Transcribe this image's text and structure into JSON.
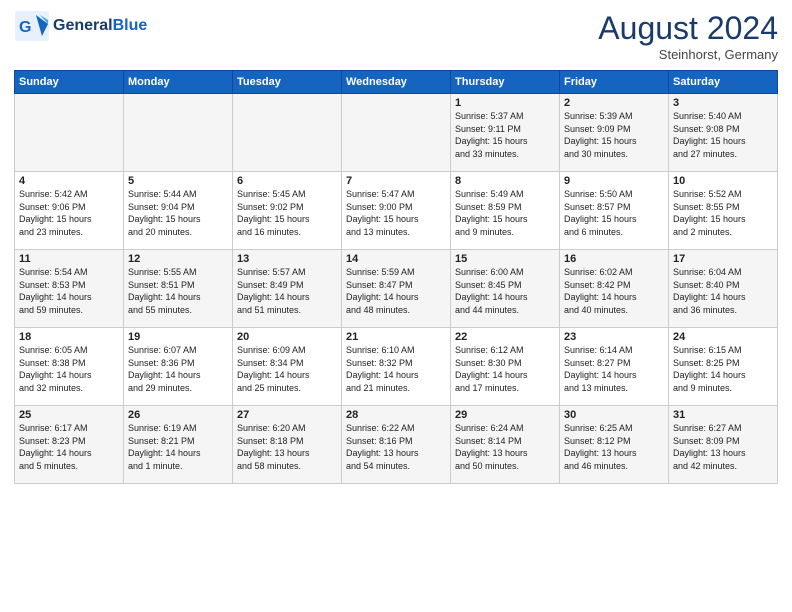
{
  "header": {
    "logo_general": "General",
    "logo_blue": "Blue",
    "month_year": "August 2024",
    "location": "Steinhorst, Germany"
  },
  "weekdays": [
    "Sunday",
    "Monday",
    "Tuesday",
    "Wednesday",
    "Thursday",
    "Friday",
    "Saturday"
  ],
  "weeks": [
    [
      {
        "day": "",
        "info": ""
      },
      {
        "day": "",
        "info": ""
      },
      {
        "day": "",
        "info": ""
      },
      {
        "day": "",
        "info": ""
      },
      {
        "day": "1",
        "info": "Sunrise: 5:37 AM\nSunset: 9:11 PM\nDaylight: 15 hours\nand 33 minutes."
      },
      {
        "day": "2",
        "info": "Sunrise: 5:39 AM\nSunset: 9:09 PM\nDaylight: 15 hours\nand 30 minutes."
      },
      {
        "day": "3",
        "info": "Sunrise: 5:40 AM\nSunset: 9:08 PM\nDaylight: 15 hours\nand 27 minutes."
      }
    ],
    [
      {
        "day": "4",
        "info": "Sunrise: 5:42 AM\nSunset: 9:06 PM\nDaylight: 15 hours\nand 23 minutes."
      },
      {
        "day": "5",
        "info": "Sunrise: 5:44 AM\nSunset: 9:04 PM\nDaylight: 15 hours\nand 20 minutes."
      },
      {
        "day": "6",
        "info": "Sunrise: 5:45 AM\nSunset: 9:02 PM\nDaylight: 15 hours\nand 16 minutes."
      },
      {
        "day": "7",
        "info": "Sunrise: 5:47 AM\nSunset: 9:00 PM\nDaylight: 15 hours\nand 13 minutes."
      },
      {
        "day": "8",
        "info": "Sunrise: 5:49 AM\nSunset: 8:59 PM\nDaylight: 15 hours\nand 9 minutes."
      },
      {
        "day": "9",
        "info": "Sunrise: 5:50 AM\nSunset: 8:57 PM\nDaylight: 15 hours\nand 6 minutes."
      },
      {
        "day": "10",
        "info": "Sunrise: 5:52 AM\nSunset: 8:55 PM\nDaylight: 15 hours\nand 2 minutes."
      }
    ],
    [
      {
        "day": "11",
        "info": "Sunrise: 5:54 AM\nSunset: 8:53 PM\nDaylight: 14 hours\nand 59 minutes."
      },
      {
        "day": "12",
        "info": "Sunrise: 5:55 AM\nSunset: 8:51 PM\nDaylight: 14 hours\nand 55 minutes."
      },
      {
        "day": "13",
        "info": "Sunrise: 5:57 AM\nSunset: 8:49 PM\nDaylight: 14 hours\nand 51 minutes."
      },
      {
        "day": "14",
        "info": "Sunrise: 5:59 AM\nSunset: 8:47 PM\nDaylight: 14 hours\nand 48 minutes."
      },
      {
        "day": "15",
        "info": "Sunrise: 6:00 AM\nSunset: 8:45 PM\nDaylight: 14 hours\nand 44 minutes."
      },
      {
        "day": "16",
        "info": "Sunrise: 6:02 AM\nSunset: 8:42 PM\nDaylight: 14 hours\nand 40 minutes."
      },
      {
        "day": "17",
        "info": "Sunrise: 6:04 AM\nSunset: 8:40 PM\nDaylight: 14 hours\nand 36 minutes."
      }
    ],
    [
      {
        "day": "18",
        "info": "Sunrise: 6:05 AM\nSunset: 8:38 PM\nDaylight: 14 hours\nand 32 minutes."
      },
      {
        "day": "19",
        "info": "Sunrise: 6:07 AM\nSunset: 8:36 PM\nDaylight: 14 hours\nand 29 minutes."
      },
      {
        "day": "20",
        "info": "Sunrise: 6:09 AM\nSunset: 8:34 PM\nDaylight: 14 hours\nand 25 minutes."
      },
      {
        "day": "21",
        "info": "Sunrise: 6:10 AM\nSunset: 8:32 PM\nDaylight: 14 hours\nand 21 minutes."
      },
      {
        "day": "22",
        "info": "Sunrise: 6:12 AM\nSunset: 8:30 PM\nDaylight: 14 hours\nand 17 minutes."
      },
      {
        "day": "23",
        "info": "Sunrise: 6:14 AM\nSunset: 8:27 PM\nDaylight: 14 hours\nand 13 minutes."
      },
      {
        "day": "24",
        "info": "Sunrise: 6:15 AM\nSunset: 8:25 PM\nDaylight: 14 hours\nand 9 minutes."
      }
    ],
    [
      {
        "day": "25",
        "info": "Sunrise: 6:17 AM\nSunset: 8:23 PM\nDaylight: 14 hours\nand 5 minutes."
      },
      {
        "day": "26",
        "info": "Sunrise: 6:19 AM\nSunset: 8:21 PM\nDaylight: 14 hours\nand 1 minute."
      },
      {
        "day": "27",
        "info": "Sunrise: 6:20 AM\nSunset: 8:18 PM\nDaylight: 13 hours\nand 58 minutes."
      },
      {
        "day": "28",
        "info": "Sunrise: 6:22 AM\nSunset: 8:16 PM\nDaylight: 13 hours\nand 54 minutes."
      },
      {
        "day": "29",
        "info": "Sunrise: 6:24 AM\nSunset: 8:14 PM\nDaylight: 13 hours\nand 50 minutes."
      },
      {
        "day": "30",
        "info": "Sunrise: 6:25 AM\nSunset: 8:12 PM\nDaylight: 13 hours\nand 46 minutes."
      },
      {
        "day": "31",
        "info": "Sunrise: 6:27 AM\nSunset: 8:09 PM\nDaylight: 13 hours\nand 42 minutes."
      }
    ]
  ]
}
